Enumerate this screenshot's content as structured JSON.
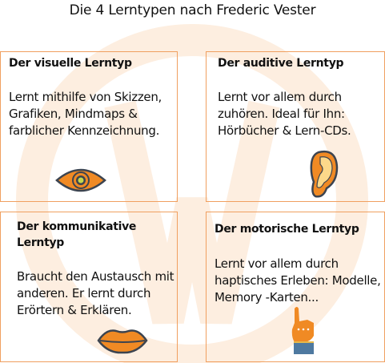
{
  "title": "Die 4 Lerntypen nach Frederic Vester",
  "colors": {
    "accent": "#f08a24",
    "border": "#f0a060",
    "watermark": "#fdeede",
    "outline": "#3c4450"
  },
  "cards": [
    {
      "heading": "Der visuelle Lerntyp",
      "text": "Lernt mithilfe von Skizzen, Grafiken, Mindmaps & farblicher Kennzeichnung.",
      "icon": "eye-icon"
    },
    {
      "heading": "Der auditive Lerntyp",
      "text": "Lernt vor allem durch zuhören. Ideal für Ihn: Hörbücher & Lern-CDs.",
      "icon": "ear-icon"
    },
    {
      "heading": "Der kommunikative Lerntyp",
      "text": "Braucht den Austausch mit anderen. Er lernt durch Erörtern & Erklären.",
      "icon": "lips-icon"
    },
    {
      "heading": "Der motorische Lerntyp",
      "text": "Lernt vor allem durch haptisches Erleben: Modelle, Memory -Karten...",
      "icon": "pointing-hand-icon"
    }
  ]
}
